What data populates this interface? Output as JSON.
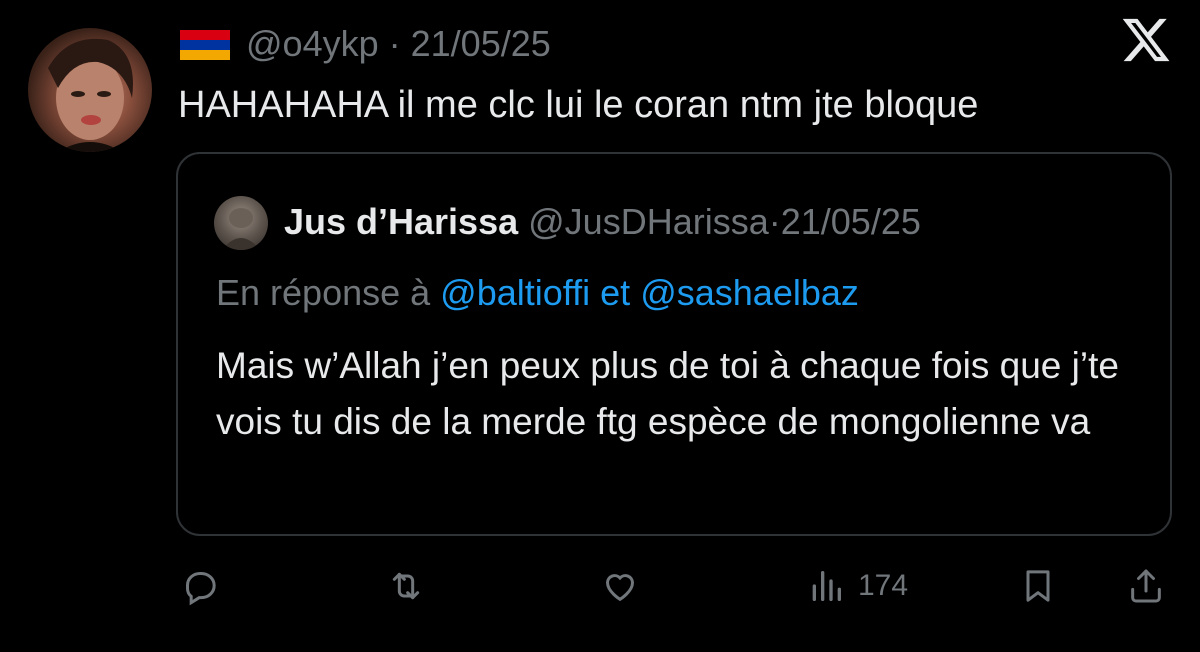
{
  "author": {
    "flag": "Armenia flag",
    "handle": "@o4ykp",
    "separator": "·",
    "date": "21/05/25"
  },
  "brand": {
    "logo_icon": "x-logo-icon"
  },
  "tweet": {
    "text": "HAHAHAHA il me clc lui le coran ntm jte bloque"
  },
  "quote": {
    "name": "Jus d’Harissa",
    "handle": "@JusDHarissa",
    "separator": "·",
    "date": "21/05/25",
    "reply_prefix": "En réponse à",
    "mention_1": "@baltioffi",
    "reply_joiner": "et",
    "mention_2": "@sashaelbaz",
    "body": "Mais w’Allah j’en peux plus de toi à chaque fois que j’te vois tu dis de la merde ftg espèce de mongolienne va"
  },
  "actions": {
    "reply_icon": "reply-icon",
    "retweet_icon": "retweet-icon",
    "like_icon": "heart-icon",
    "views_icon": "views-chart-icon",
    "views_count": "174",
    "bookmark_icon": "bookmark-icon",
    "share_icon": "share-icon"
  },
  "colors": {
    "background": "#000000",
    "text": "#e7e9ea",
    "muted": "#71767b",
    "link": "#1d9bf0",
    "border": "#2f3336"
  }
}
